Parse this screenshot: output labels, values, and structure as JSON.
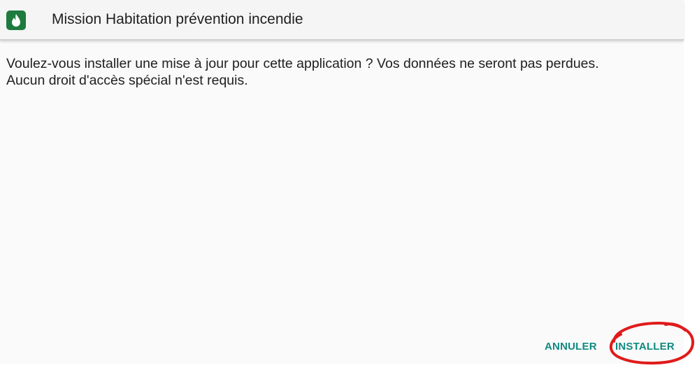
{
  "header": {
    "app_icon": "fire-drop-icon",
    "title": "Mission Habitation prévention incendie"
  },
  "message": {
    "line1": "Voulez-vous installer une mise à jour pour cette application ? Vos données ne seront pas perdues.",
    "line2": "Aucun droit d'accès spécial n'est requis."
  },
  "actions": {
    "cancel_label": "ANNULER",
    "install_label": "INSTALLER"
  },
  "colors": {
    "accent": "#0f8a80",
    "app_icon_bg": "#1e7a3e",
    "annotation": "#e01b1b"
  }
}
